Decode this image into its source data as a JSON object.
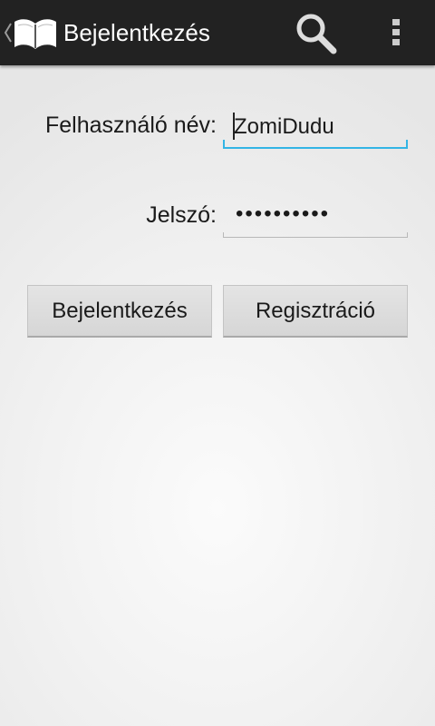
{
  "action_bar": {
    "title": "Bejelentkezés",
    "up_icon": "chevron-left-icon",
    "app_icon": "open-book-icon",
    "search_icon": "search-icon",
    "overflow_icon": "overflow-menu-icon",
    "background": "#222222"
  },
  "form": {
    "username_label": "Felhasználó név:",
    "username_value": "ZomiDudu",
    "password_label": "Jelszó:",
    "password_value": "••••••••••",
    "accent_color": "#33b5e5"
  },
  "buttons": {
    "login_label": "Bejelentkezés",
    "register_label": "Regisztráció"
  }
}
